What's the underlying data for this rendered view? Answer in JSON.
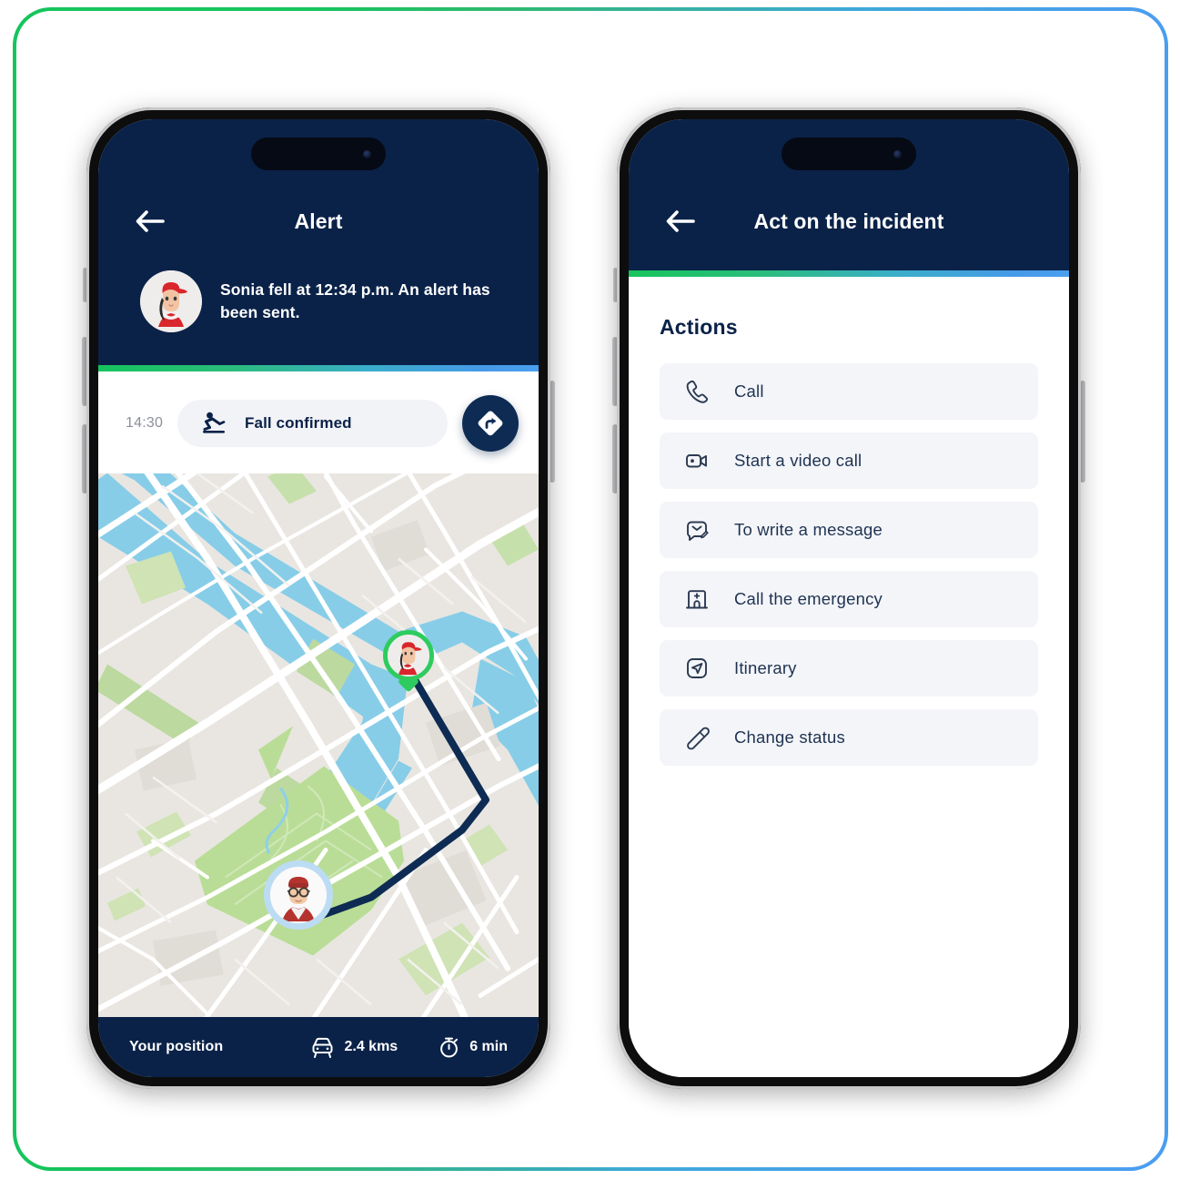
{
  "theme": {
    "navy": "#0a2248",
    "green": "#16c45c",
    "blue": "#4a9eef",
    "chip_bg": "#f2f3f7",
    "map_land": "#e9e6e1",
    "map_water": "#87cde8",
    "map_park": "#b9dd96",
    "route": "#0d2b53"
  },
  "alert_screen": {
    "back_icon": "arrow-left-icon",
    "title": "Alert",
    "avatar_icon": "avatar-sonia",
    "alert_message": "Sonia fell at 12:34 p.m. An alert has been sent.",
    "status": {
      "time": "14:30",
      "icon": "person-falling-icon",
      "label": "Fall confirmed",
      "nav_button_icon": "navigation-arrow-icon"
    },
    "map": {
      "victim_marker_icon": "avatar-victim-marker",
      "responder_marker_icon": "avatar-responder-marker"
    },
    "footer": {
      "position_label": "Your position",
      "distance_icon": "car-icon",
      "distance": "2.4 kms",
      "duration_icon": "stopwatch-icon",
      "duration": "6 min"
    }
  },
  "actions_screen": {
    "back_icon": "arrow-left-icon",
    "title": "Act on the incident",
    "section_title": "Actions",
    "items": [
      {
        "icon": "phone-icon",
        "label": "Call"
      },
      {
        "icon": "video-icon",
        "label": "Start a video call"
      },
      {
        "icon": "message-edit-icon",
        "label": "To write a message"
      },
      {
        "icon": "hospital-icon",
        "label": "Call the emergency"
      },
      {
        "icon": "navigation-icon",
        "label": "Itinerary"
      },
      {
        "icon": "pencil-icon",
        "label": "Change status"
      }
    ]
  }
}
